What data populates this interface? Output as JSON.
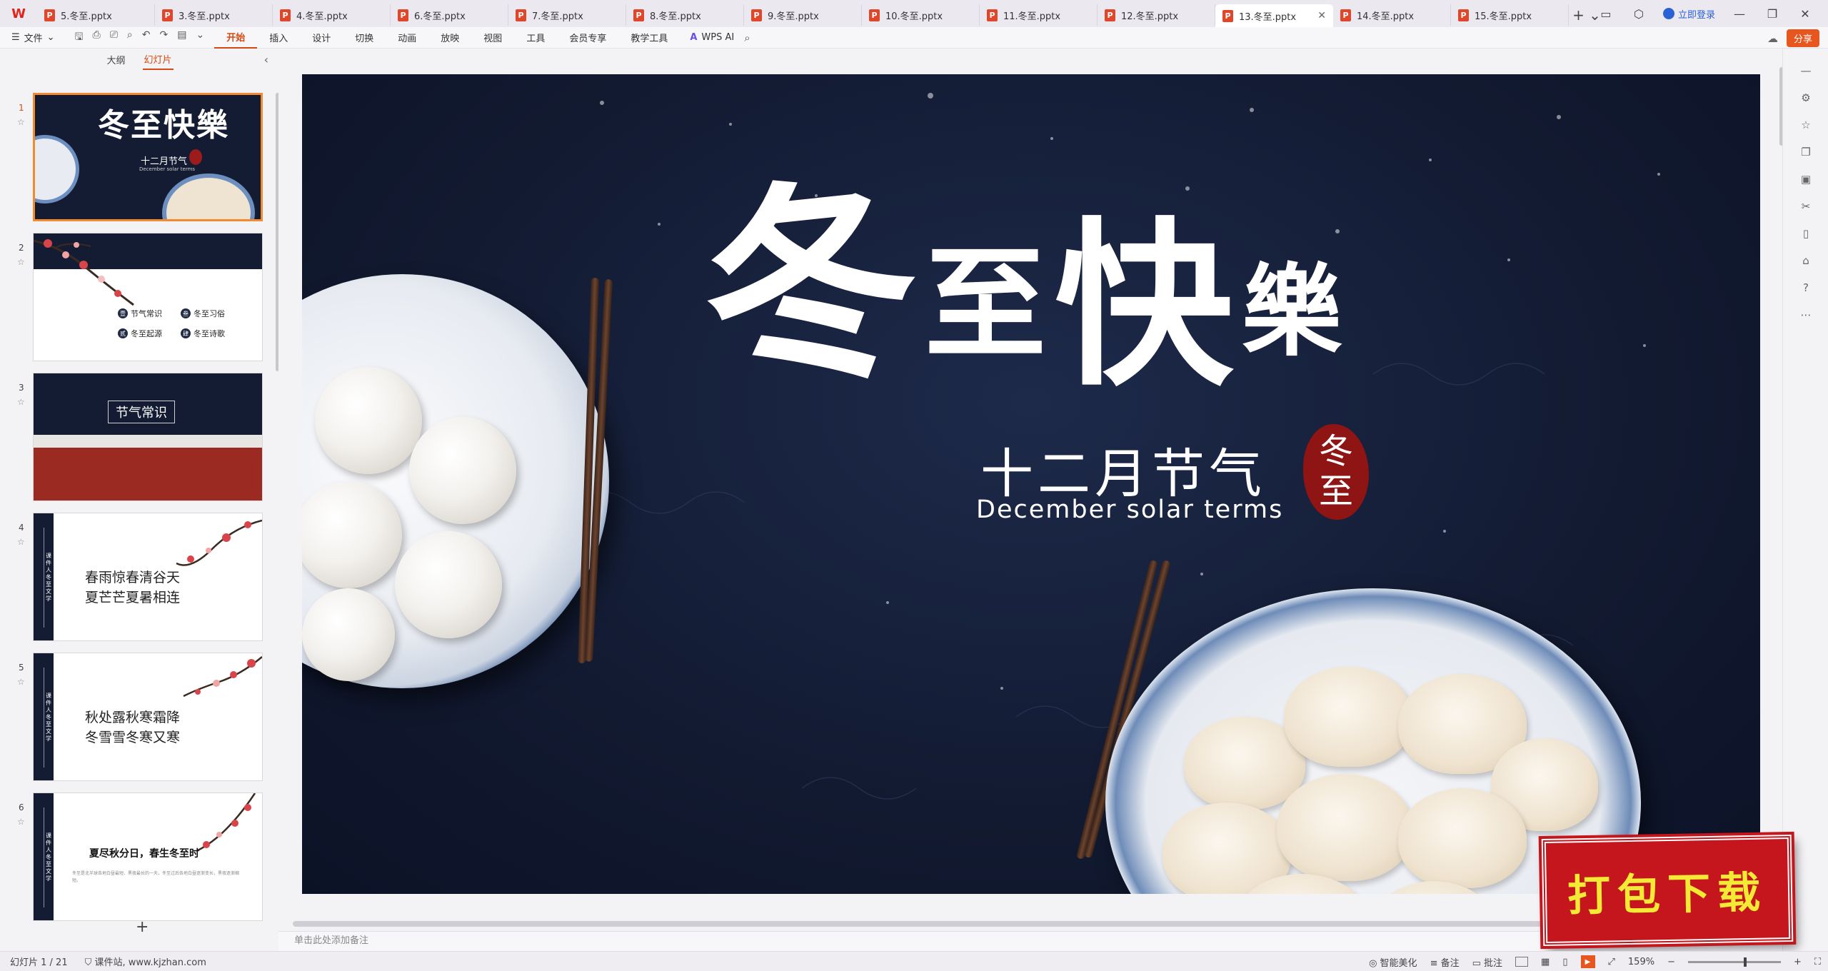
{
  "app": {
    "logo_glyph": "W"
  },
  "tabs": [
    {
      "label": "5.冬至.pptx"
    },
    {
      "label": "3.冬至.pptx"
    },
    {
      "label": "4.冬至.pptx"
    },
    {
      "label": "6.冬至.pptx"
    },
    {
      "label": "7.冬至.pptx"
    },
    {
      "label": "8.冬至.pptx"
    },
    {
      "label": "9.冬至.pptx"
    },
    {
      "label": "10.冬至.pptx"
    },
    {
      "label": "11.冬至.pptx"
    },
    {
      "label": "12.冬至.pptx"
    },
    {
      "label": "13.冬至.pptx",
      "active": true
    },
    {
      "label": "14.冬至.pptx"
    },
    {
      "label": "15.冬至.pptx"
    }
  ],
  "tab_add_glyph": "+ ⌄",
  "titlebar": {
    "login_label": "立即登录",
    "share_label": "分享"
  },
  "menubar": {
    "file_label": "文件",
    "items": [
      "开始",
      "插入",
      "设计",
      "切换",
      "动画",
      "放映",
      "视图",
      "工具",
      "会员专享",
      "教学工具"
    ],
    "active_item": "开始",
    "ai_label": "WPS AI"
  },
  "left_panel": {
    "tab_outline": "大纲",
    "tab_slides": "幻灯片",
    "active_tab": "幻灯片",
    "add_slide_glyph": "+",
    "slides": [
      {
        "num": "1",
        "title": "冬至快樂",
        "sub_cn": "十二月节气",
        "sub_en": "December solar terms"
      },
      {
        "num": "2",
        "items": [
          "节气常识",
          "冬至习俗",
          "冬至起源",
          "冬至诗歌"
        ],
        "badges": [
          "壹",
          "叁",
          "贰",
          "肆"
        ]
      },
      {
        "num": "3",
        "title": "节气常识"
      },
      {
        "num": "4",
        "poem": [
          "春雨惊春清谷天",
          "夏芒芒夏暑相连"
        ],
        "vert": "课件人冬至文学"
      },
      {
        "num": "5",
        "poem": [
          "秋处露秋寒霜降",
          "冬雪雪冬寒又寒"
        ],
        "vert": "课件人冬至文学"
      },
      {
        "num": "6",
        "title": "夏尽秋分日，春生冬至时",
        "vert": "课件人冬至文学",
        "text": "冬至是北半球各地白昼最短、黑夜最长的一天，冬至过后各地白昼逐渐变长，黑夜逐渐缩短。"
      }
    ]
  },
  "slide": {
    "title_chars": [
      "冬",
      "至",
      "快",
      "樂"
    ],
    "subtitle_cn": "十二月节气",
    "subtitle_en": "December solar terms",
    "seal_text_top": "冬",
    "seal_text_bottom": "至",
    "colors": {
      "background": "#141c33",
      "seal": "#8f1414"
    }
  },
  "notes_placeholder": "单击此处添加备注",
  "download_badge": "打包下载",
  "statusbar": {
    "slide_counter": "幻灯片 1 / 21",
    "website": "课件站, www.kjzhan.com",
    "smart_beautify": "智能美化",
    "notes": "备注",
    "comments": "批注",
    "zoom": "159%"
  }
}
